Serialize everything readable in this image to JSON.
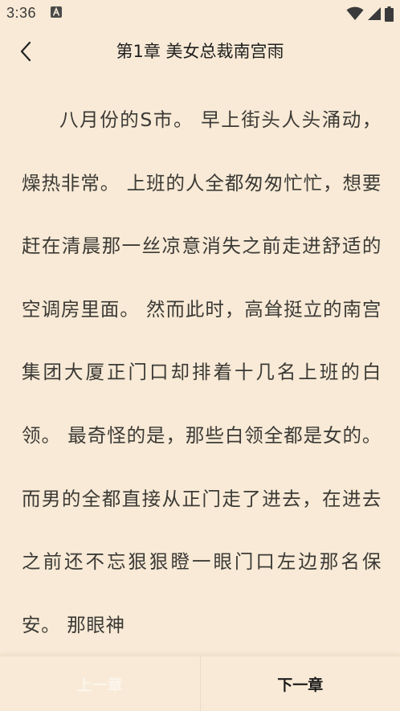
{
  "status_bar": {
    "time": "3:36",
    "notification_icon": "a-square-icon",
    "icons": [
      "wifi-icon",
      "signal-icon",
      "battery-icon"
    ]
  },
  "header": {
    "back_icon": "chevron-left-icon",
    "title": "第1章 美女总裁南宫雨"
  },
  "content": {
    "text": "八月份的S市。 早上街头人头涌动，燥热非常。 上班的人全都匆匆忙忙，想要赶在清晨那一丝凉意消失之前走进舒适的空调房里面。 然而此时，高耸挺立的南宫集团大厦正门口却排着十几名上班的白领。 最奇怪的是，那些白领全都是女的。 而男的全都直接从正门走了进去，在进去之前还不忘狠狠瞪一眼门口左边那名保安。 那眼神"
  },
  "footer": {
    "prev_label": "上一章",
    "next_label": "下一章"
  },
  "colors": {
    "background": "#f8ead6",
    "text": "#3c3a36",
    "prev_label_disabled": "#fbf5ec"
  }
}
